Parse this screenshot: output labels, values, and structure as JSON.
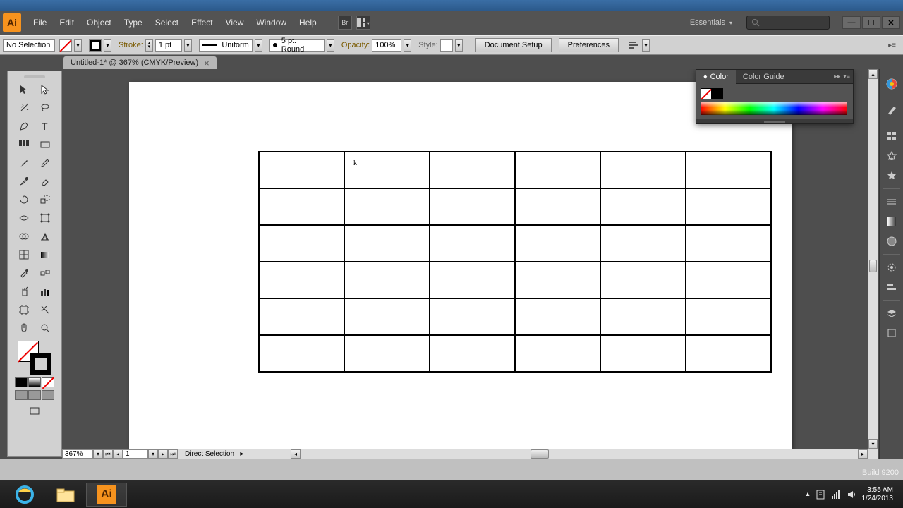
{
  "app": {
    "logo": "Ai"
  },
  "menu": [
    "File",
    "Edit",
    "Object",
    "Type",
    "Select",
    "Effect",
    "View",
    "Window",
    "Help"
  ],
  "workspace": "Essentials",
  "controlbar": {
    "selection": "No Selection",
    "stroke_label": "Stroke:",
    "stroke_weight": "1 pt",
    "profile": "Uniform",
    "brush": "5 pt. Round",
    "opacity_label": "Opacity:",
    "opacity_value": "100%",
    "style_label": "Style:",
    "doc_setup": "Document Setup",
    "preferences": "Preferences"
  },
  "document": {
    "tab": "Untitled-1* @ 367% (CMYK/Preview)"
  },
  "color_panel": {
    "tab1": "Color",
    "tab2": "Color Guide"
  },
  "status": {
    "zoom": "367%",
    "page": "1",
    "tool": "Direct Selection"
  },
  "grid": {
    "rows": 6,
    "cols": 6
  },
  "taskbar": {
    "time": "3:55 AM",
    "date": "1/24/2013",
    "build": "Build 9200"
  }
}
